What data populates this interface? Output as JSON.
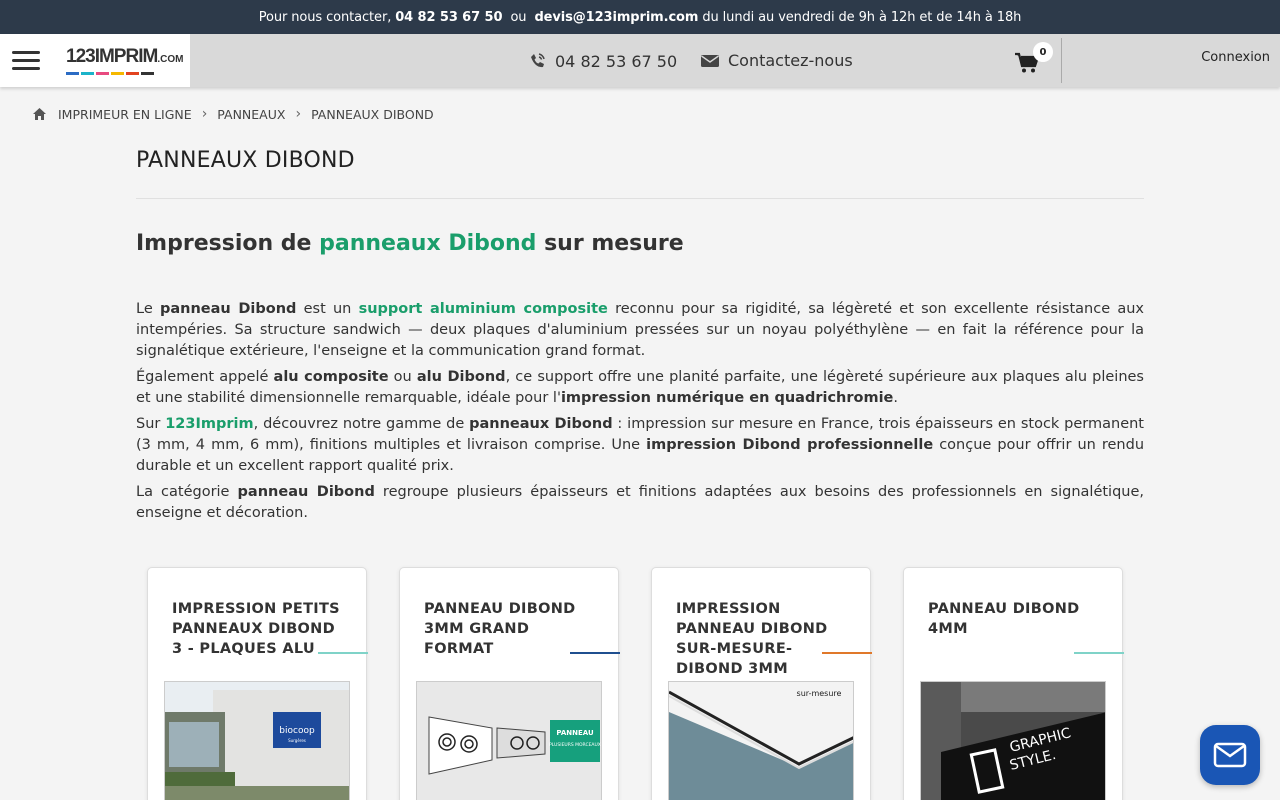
{
  "topbar": {
    "prefix": "Pour nous contacter,",
    "phone": "04 82 53 67 50",
    "or": " ou ",
    "email": "devis@123imprim.com",
    "hours": "du lundi au vendredi de 9h à 12h et de 14h à 18h"
  },
  "header": {
    "logo_main": "123IMPRIM",
    "logo_suffix": ".COM",
    "phone": "04 82 53 67 50",
    "contact": "Contactez-nous",
    "cart_count": "0",
    "login": "Connexion"
  },
  "breadcrumb": {
    "items": [
      "IMPRIMEUR EN LIGNE",
      "PANNEAUX",
      "PANNEAUX DIBOND"
    ]
  },
  "page": {
    "title": "PANNEAUX DIBOND",
    "subtitle_pre": "Impression de ",
    "subtitle_highlight": "panneaux Dibond",
    "subtitle_post": " sur mesure"
  },
  "description": {
    "p1": [
      "Le ",
      "panneau Dibond",
      " est un ",
      "support aluminium composite",
      " reconnu pour sa rigidité, sa légèreté et son excellente résistance aux intempéries. Sa structure sandwich — deux plaques d'aluminium pressées sur un noyau polyéthylène — en fait la référence pour la signalétique extérieure, l'enseigne et la communication grand format."
    ],
    "p2": [
      "Également appelé ",
      "alu composite",
      " ou ",
      "alu Dibond",
      ", ce support offre une planité parfaite, une légèreté supérieure aux plaques alu pleines et une stabilité dimensionnelle remarquable, idéale pour l'",
      "impression numérique en quadrichromie",
      "."
    ],
    "p3": [
      "Sur ",
      "123Imprim",
      ", découvrez notre gamme de ",
      "panneaux Dibond",
      " : impression sur mesure en France, trois épaisseurs en stock permanent (3 mm, 4 mm, 6 mm), finitions multiples et livraison comprise. Une ",
      "impression Dibond professionnelle",
      " conçue pour offrir un rendu durable et un excellent rapport qualité prix."
    ],
    "p4": [
      "La catégorie ",
      "panneau Dibond",
      " regroupe plusieurs épaisseurs et finitions adaptées aux besoins des professionnels en signalétique, enseigne et décoration."
    ]
  },
  "cards": [
    {
      "title": "IMPRESSION PETITS PANNEAUX DIBOND 3 - PLAQUES ALU",
      "accent": "#7fd3c8",
      "img_text": "biocoop",
      "img_sub": "Surgères"
    },
    {
      "title": "PANNEAU DIBOND 3MM GRAND FORMAT",
      "accent": "#1f4f8f",
      "img_text": "PANNEAU",
      "img_sub": "PLUSIEURS MORCEAUX"
    },
    {
      "title": "IMPRESSION PANNEAU DIBOND SUR-MESURE-DIBOND 3MM",
      "accent": "#e0782a",
      "img_text": "sur-mesure",
      "img_sub": ""
    },
    {
      "title": "PANNEAU DIBOND 4MM",
      "accent": "#7fd3c8",
      "img_text": "GRAPHIC",
      "img_sub": "STYLE."
    }
  ],
  "colors": {
    "topbar_bg": "#2d3a4a",
    "accent_green": "#1a9e6b",
    "chat_blue": "#1a56b5"
  },
  "icons": [
    "menu-icon",
    "phone-icon",
    "mail-icon",
    "cart-icon",
    "home-icon",
    "chevron-right-icon",
    "chat-mail-icon"
  ]
}
